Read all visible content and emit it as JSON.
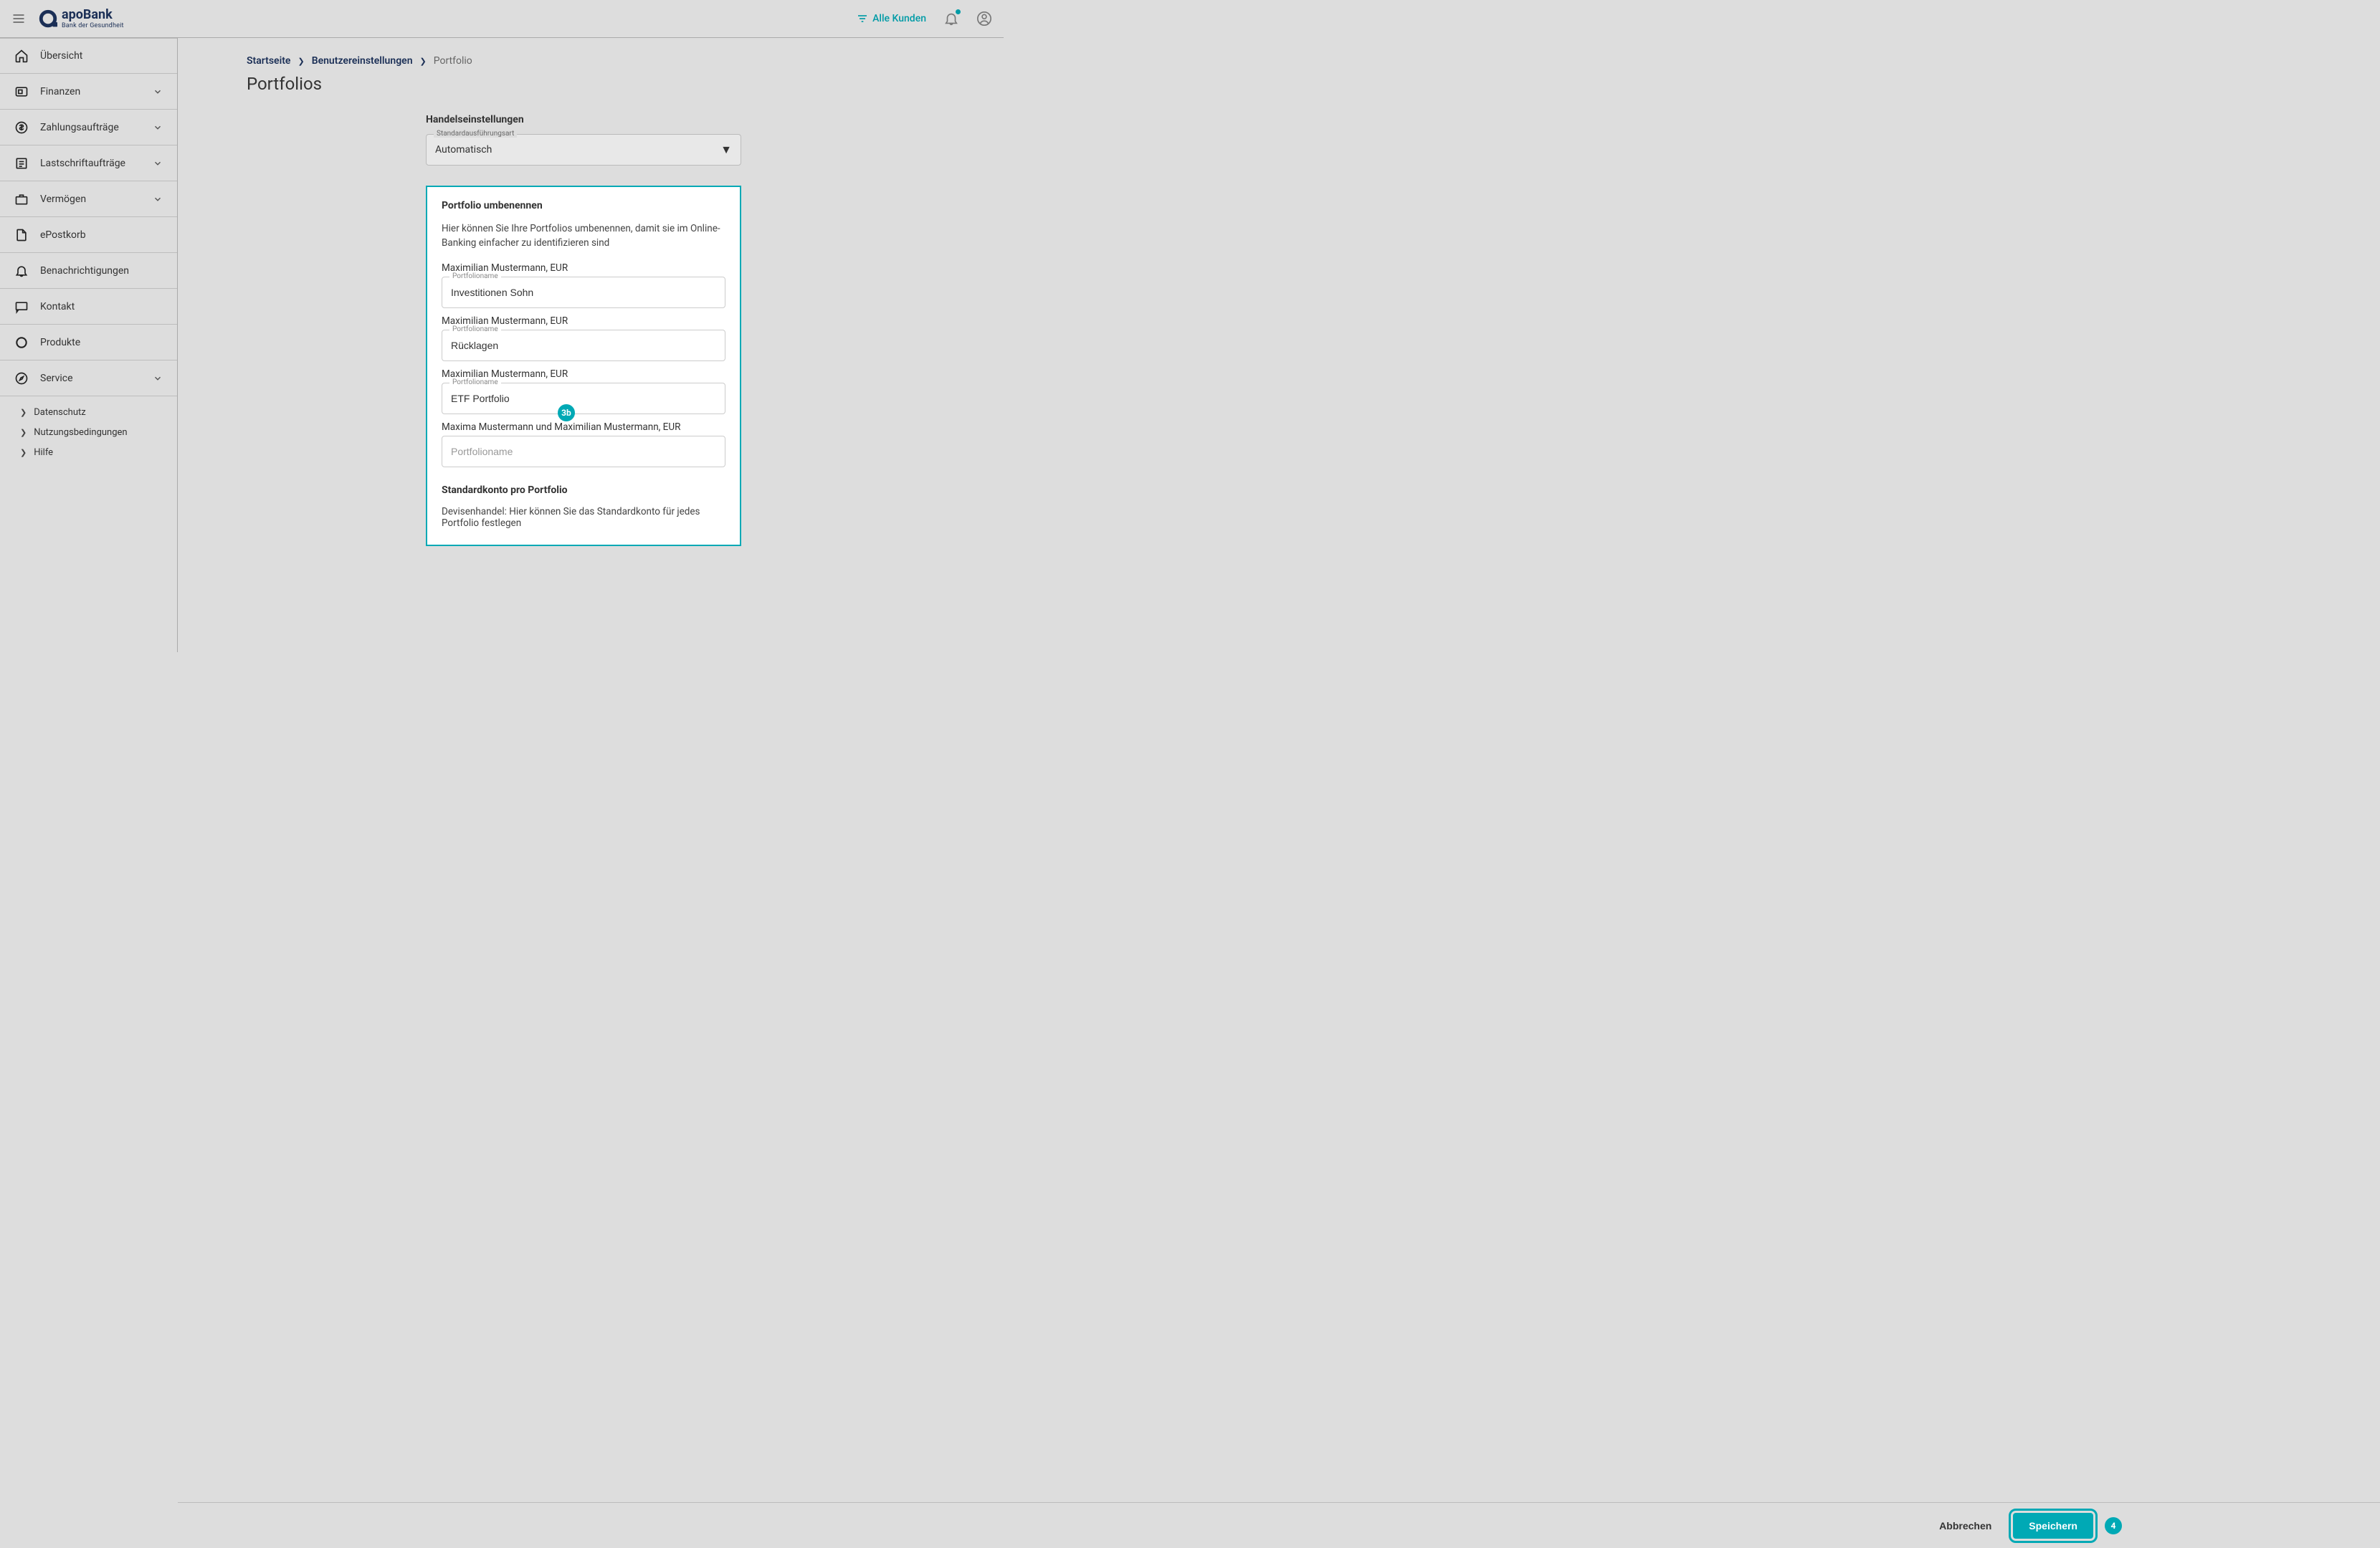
{
  "brand": {
    "name": "apoBank",
    "tagline": "Bank der Gesundheit"
  },
  "topbar": {
    "filter_label": "Alle Kunden"
  },
  "sidebar": {
    "items": [
      {
        "label": "Übersicht",
        "expandable": false
      },
      {
        "label": "Finanzen",
        "expandable": true
      },
      {
        "label": "Zahlungsaufträge",
        "expandable": true
      },
      {
        "label": "Lastschriftaufträge",
        "expandable": true
      },
      {
        "label": "Vermögen",
        "expandable": true
      },
      {
        "label": "ePostkorb",
        "expandable": false
      },
      {
        "label": "Benachrichtigungen",
        "expandable": false
      },
      {
        "label": "Kontakt",
        "expandable": false
      },
      {
        "label": "Produkte",
        "expandable": false
      },
      {
        "label": "Service",
        "expandable": true
      }
    ],
    "sub_items": [
      {
        "label": "Datenschutz"
      },
      {
        "label": "Nutzungsbedingungen"
      },
      {
        "label": "Hilfe"
      }
    ]
  },
  "breadcrumb": {
    "home": "Startseite",
    "settings": "Benutzereinstellungen",
    "current": "Portfolio"
  },
  "page_title": "Portfolios",
  "trade_settings": {
    "heading": "Handelseinstellungen",
    "select_label": "Standardausführungsart",
    "select_value": "Automatisch"
  },
  "rename": {
    "heading": "Portfolio umbenennen",
    "description": "Hier können Sie Ihre Portfolios umbenennen, damit sie im Online-Banking einfacher zu identifizieren sind",
    "field_label": "Portfolioname",
    "placeholder": "Portfolioname",
    "portfolios": [
      {
        "owner": "Maximilian Mustermann, EUR",
        "value": "Investitionen Sohn"
      },
      {
        "owner": "Maximilian Mustermann, EUR",
        "value": "Rücklagen"
      },
      {
        "owner": "Maximilian Mustermann, EUR",
        "value": "ETF Portfolio"
      },
      {
        "owner": "Maxima Mustermann und Maximilian Mustermann, EUR",
        "value": ""
      }
    ],
    "default_account_heading": "Standardkonto pro Portfolio",
    "default_account_desc": "Devisenhandel: Hier können Sie das Standardkonto für jedes Portfolio festlegen"
  },
  "actions": {
    "cancel": "Abbrechen",
    "save": "Speichern"
  },
  "badges": {
    "b3b": "3b",
    "b4": "4"
  }
}
